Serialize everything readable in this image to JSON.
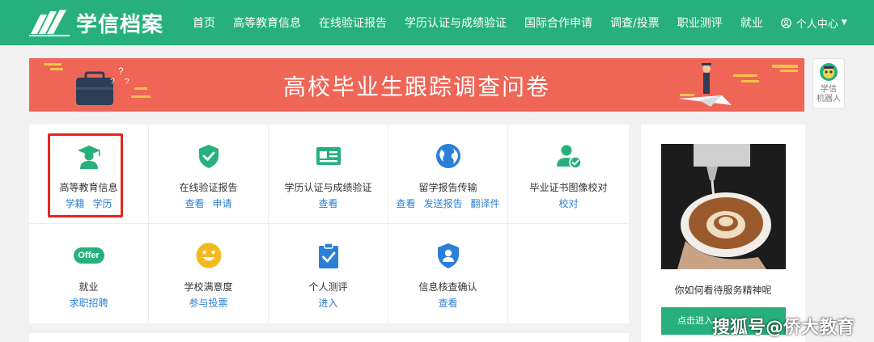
{
  "brand": {
    "name": "学信档案",
    "color": "#27b07d",
    "icon": "books-logo-icon"
  },
  "nav": {
    "items": [
      "首页",
      "高等教育信息",
      "在线验证报告",
      "学历认证与成绩验证",
      "国际合作申请",
      "调查/投票",
      "职业测评",
      "就业"
    ],
    "user_label": "个人中心",
    "user_icon": "user-circle-icon"
  },
  "banner": {
    "title": "高校毕业生跟踪调查问卷",
    "color": "#ef6556"
  },
  "robot": {
    "line1": "学信",
    "line2": "机器人",
    "icon": "robot-avatar-icon"
  },
  "services": [
    {
      "title": "高等教育信息",
      "links": [
        "学籍",
        "学历"
      ],
      "icon": "graduate-icon",
      "highlighted": true
    },
    {
      "title": "在线验证报告",
      "links": [
        "查看",
        "申请"
      ],
      "icon": "shield-check-icon"
    },
    {
      "title": "学历认证与成绩验证",
      "links": [
        "查看"
      ],
      "icon": "id-card-icon"
    },
    {
      "title": "留学报告传输",
      "links": [
        "查看",
        "发送报告",
        "翻译件"
      ],
      "icon": "globe-icon"
    },
    {
      "title": "毕业证书图像校对",
      "links": [
        "校对"
      ],
      "icon": "user-check-icon"
    },
    {
      "title": "就业",
      "links": [
        "求职招聘"
      ],
      "icon": "offer-badge-icon",
      "badge": "Offer"
    },
    {
      "title": "学校满意度",
      "links": [
        "参与投票"
      ],
      "icon": "smiley-icon"
    },
    {
      "title": "个人测评",
      "links": [
        "进入"
      ],
      "icon": "clipboard-check-icon"
    },
    {
      "title": "信息核查确认",
      "links": [
        "查看"
      ],
      "icon": "user-shield-icon"
    }
  ],
  "side": {
    "caption": "你如何看待服务精神呢",
    "button": "点击进入"
  },
  "watermark": "搜狐号@侨大教育",
  "colors": {
    "link": "#2a80d6",
    "highlight": "#e8231f",
    "blue": "#2a80d6",
    "yellow": "#f4b91e"
  }
}
